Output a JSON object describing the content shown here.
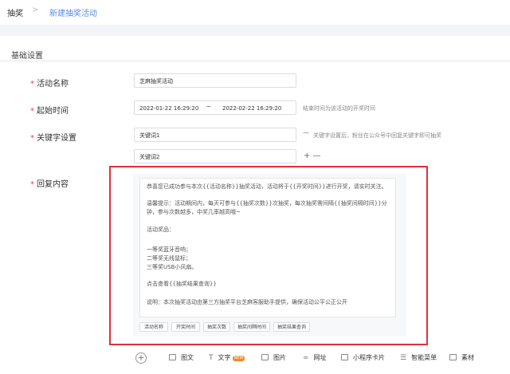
{
  "breadcrumb": {
    "root": "抽奖",
    "separator": ">",
    "current": "新建抽奖活动"
  },
  "section": {
    "title": "基础设置"
  },
  "form": {
    "required_mark": "*",
    "name": {
      "label": "活动名称",
      "value": "芝麻抽奖活动"
    },
    "time": {
      "label": "起始时间",
      "start": "2022-01-22 16:29:20",
      "dash": "~",
      "end": "2022-02-22 16:29:20",
      "hint": "结束时间为该活动的开奖时间"
    },
    "keywords": {
      "label": "关键字设置",
      "items": [
        "关键词1",
        "关键词2"
      ],
      "remove": "—",
      "hint": "关键字设置后，粉丝在公众号中回复关键字即可抽奖",
      "add_remove": "+ —"
    },
    "reply": {
      "label": "回复内容",
      "lines": [
        "恭喜您已成功参与本次{{活动名称}}抽奖活动，活动将于{{开奖时间}}进行开奖，请实时关注。",
        "温馨提示：活动期间内，每天可参与{{抽奖次数}}次抽奖，每次抽奖需间隔{{抽奖间隔时间}}分钟，参与次数越多，中奖几率越高哦~",
        "活动奖品：",
        "一等奖蓝牙音响；",
        "二等奖无线鼠标；",
        "三等奖USB小风扇。",
        "点击查看{{抽奖结果查询}}",
        "说明：本次抽奖活动由第三方抽奖平台芝麻客服助手提供，确保活动公平公正公开"
      ],
      "tags": [
        "活动名称",
        "开奖时间",
        "抽奖次数",
        "抽奖间隔时间",
        "抽奖结果查询"
      ]
    }
  },
  "toolbar": {
    "add": "+",
    "items": [
      {
        "label": "图文",
        "icon": "image-text-icon"
      },
      {
        "label": "文字",
        "icon": "text-icon",
        "badge": "NEW"
      },
      {
        "label": "图片",
        "icon": "image-icon"
      },
      {
        "label": "网址",
        "icon": "link-icon"
      },
      {
        "label": "小程序卡片",
        "icon": "mini-program-icon"
      },
      {
        "label": "智能菜单",
        "icon": "menu-icon"
      },
      {
        "label": "素材",
        "icon": "material-icon"
      }
    ]
  },
  "colors": {
    "accent": "#5a8be6",
    "required": "#e54545",
    "highlight": "#e0303a",
    "badge": "#f08a2b"
  }
}
